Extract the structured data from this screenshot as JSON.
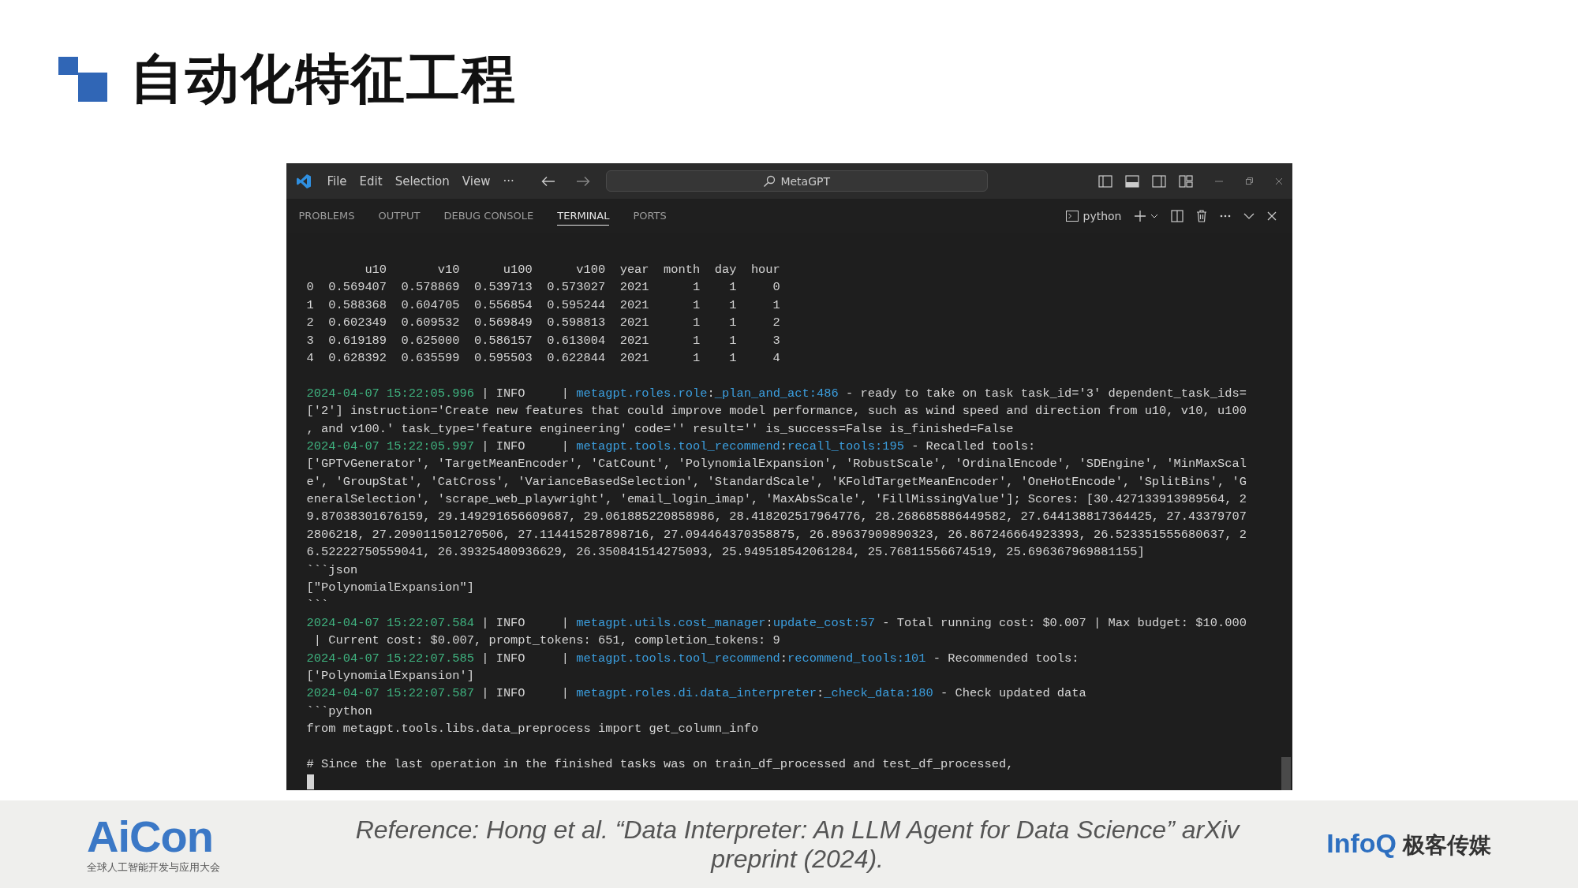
{
  "slide_title": "自动化特征工程",
  "window": {
    "menu": [
      "File",
      "Edit",
      "Selection",
      "View",
      "···"
    ],
    "command_center": "MetaGPT"
  },
  "panel": {
    "tabs": [
      {
        "label": "PROBLEMS",
        "selected": false
      },
      {
        "label": "OUTPUT",
        "selected": false
      },
      {
        "label": "DEBUG CONSOLE",
        "selected": false
      },
      {
        "label": "TERMINAL",
        "selected": true
      },
      {
        "label": "PORTS",
        "selected": false
      }
    ],
    "terminal_name": "python"
  },
  "terminal": {
    "lines": [
      {
        "kind": "text",
        "segments": [
          {
            "kind": "plain",
            "text": "        u10       v10      u100      v100  year  month  day  hour"
          }
        ]
      },
      {
        "kind": "text",
        "segments": [
          {
            "kind": "plain",
            "text": "0  0.569407  0.578869  0.539713  0.573027  2021      1    1     0"
          }
        ]
      },
      {
        "kind": "text",
        "segments": [
          {
            "kind": "plain",
            "text": "1  0.588368  0.604705  0.556854  0.595244  2021      1    1     1"
          }
        ]
      },
      {
        "kind": "text",
        "segments": [
          {
            "kind": "plain",
            "text": "2  0.602349  0.609532  0.569849  0.598813  2021      1    1     2"
          }
        ]
      },
      {
        "kind": "text",
        "segments": [
          {
            "kind": "plain",
            "text": "3  0.619189  0.625000  0.586157  0.613004  2021      1    1     3"
          }
        ]
      },
      {
        "kind": "text",
        "segments": [
          {
            "kind": "plain",
            "text": "4  0.628392  0.635599  0.595503  0.622844  2021      1    1     4"
          }
        ]
      },
      {
        "kind": "blank"
      },
      {
        "kind": "text",
        "segments": [
          {
            "kind": "time",
            "text": "2024-04-07 15:22:05.996"
          },
          {
            "kind": "plain",
            "text": " | INFO     | "
          },
          {
            "kind": "module",
            "text": "metagpt.roles.role"
          },
          {
            "kind": "plain",
            "text": ":"
          },
          {
            "kind": "module",
            "text": "_plan_and_act:486"
          },
          {
            "kind": "plain",
            "text": " - ready to take on task task_id='3' dependent_task_ids="
          }
        ]
      },
      {
        "kind": "text",
        "segments": [
          {
            "kind": "plain",
            "text": "['2'] instruction='Create new features that could improve model performance, such as wind speed and direction from u10, v10, u100"
          }
        ]
      },
      {
        "kind": "text",
        "segments": [
          {
            "kind": "plain",
            "text": ", and v100.' task_type='feature engineering' code='' result='' is_success=False is_finished=False"
          }
        ]
      },
      {
        "kind": "text",
        "segments": [
          {
            "kind": "time",
            "text": "2024-04-07 15:22:05.997"
          },
          {
            "kind": "plain",
            "text": " | INFO     | "
          },
          {
            "kind": "module",
            "text": "metagpt.tools.tool_recommend"
          },
          {
            "kind": "plain",
            "text": ":"
          },
          {
            "kind": "module",
            "text": "recall_tools:195"
          },
          {
            "kind": "plain",
            "text": " - Recalled tools:"
          }
        ]
      },
      {
        "kind": "text",
        "segments": [
          {
            "kind": "plain",
            "text": "['GPTvGenerator', 'TargetMeanEncoder', 'CatCount', 'PolynomialExpansion', 'RobustScale', 'OrdinalEncode', 'SDEngine', 'MinMaxScal"
          }
        ]
      },
      {
        "kind": "text",
        "segments": [
          {
            "kind": "plain",
            "text": "e', 'GroupStat', 'CatCross', 'VarianceBasedSelection', 'StandardScale', 'KFoldTargetMeanEncoder', 'OneHotEncode', 'SplitBins', 'G"
          }
        ]
      },
      {
        "kind": "text",
        "segments": [
          {
            "kind": "plain",
            "text": "eneralSelection', 'scrape_web_playwright', 'email_login_imap', 'MaxAbsScale', 'FillMissingValue']; Scores: [30.427133913989564, 2"
          }
        ]
      },
      {
        "kind": "text",
        "segments": [
          {
            "kind": "plain",
            "text": "9.87038301676159, 29.149291656609687, 29.061885220858986, 28.418202517964776, 28.268685886449582, 27.644138817364425, 27.43379707"
          }
        ]
      },
      {
        "kind": "text",
        "segments": [
          {
            "kind": "plain",
            "text": "2806218, 27.209011501270506, 27.114415287898716, 27.094464370358875, 26.89637909890323, 26.867246664923393, 26.523351555680637, 2"
          }
        ]
      },
      {
        "kind": "text",
        "segments": [
          {
            "kind": "plain",
            "text": "6.52222750559041, 26.39325480936629, 26.350841514275093, 25.949518542061284, 25.76811556674519, 25.696367969881155]"
          }
        ]
      },
      {
        "kind": "text",
        "segments": [
          {
            "kind": "plain",
            "text": "```json"
          }
        ]
      },
      {
        "kind": "text",
        "segments": [
          {
            "kind": "plain",
            "text": "[\"PolynomialExpansion\"]"
          }
        ]
      },
      {
        "kind": "text",
        "segments": [
          {
            "kind": "plain",
            "text": "```"
          }
        ]
      },
      {
        "kind": "text",
        "segments": [
          {
            "kind": "time",
            "text": "2024-04-07 15:22:07.584"
          },
          {
            "kind": "plain",
            "text": " | INFO     | "
          },
          {
            "kind": "module",
            "text": "metagpt.utils.cost_manager"
          },
          {
            "kind": "plain",
            "text": ":"
          },
          {
            "kind": "module",
            "text": "update_cost:57"
          },
          {
            "kind": "plain",
            "text": " - Total running cost: $0.007 | Max budget: $10.000"
          }
        ]
      },
      {
        "kind": "text",
        "segments": [
          {
            "kind": "plain",
            "text": " | Current cost: $0.007, prompt_tokens: 651, completion_tokens: 9"
          }
        ]
      },
      {
        "kind": "text",
        "segments": [
          {
            "kind": "time",
            "text": "2024-04-07 15:22:07.585"
          },
          {
            "kind": "plain",
            "text": " | INFO     | "
          },
          {
            "kind": "module",
            "text": "metagpt.tools.tool_recommend"
          },
          {
            "kind": "plain",
            "text": ":"
          },
          {
            "kind": "module",
            "text": "recommend_tools:101"
          },
          {
            "kind": "plain",
            "text": " - Recommended tools:"
          }
        ]
      },
      {
        "kind": "text",
        "segments": [
          {
            "kind": "plain",
            "text": "['PolynomialExpansion']"
          }
        ]
      },
      {
        "kind": "text",
        "segments": [
          {
            "kind": "time",
            "text": "2024-04-07 15:22:07.587"
          },
          {
            "kind": "plain",
            "text": " | INFO     | "
          },
          {
            "kind": "module",
            "text": "metagpt.roles.di.data_interpreter"
          },
          {
            "kind": "plain",
            "text": ":"
          },
          {
            "kind": "module",
            "text": "_check_data:180"
          },
          {
            "kind": "plain",
            "text": " - Check updated data"
          }
        ]
      },
      {
        "kind": "text",
        "segments": [
          {
            "kind": "plain",
            "text": "```python"
          }
        ]
      },
      {
        "kind": "text",
        "segments": [
          {
            "kind": "plain",
            "text": "from metagpt.tools.libs.data_preprocess import get_column_info"
          }
        ]
      },
      {
        "kind": "blank"
      },
      {
        "kind": "text",
        "segments": [
          {
            "kind": "plain",
            "text": "# Since the last operation in the finished tasks was on train_df_processed and test_df_processed,"
          }
        ]
      },
      {
        "kind": "cursor"
      }
    ]
  },
  "footer": {
    "logo": "AiCon",
    "logo_subtitle": "全球人工智能开发与应用大会",
    "reference": "Reference: Hong et al. “Data Interpreter: An LLM Agent for Data Science” arXiv preprint (2024).",
    "publisher": "InfoQ",
    "publisher_cn": "极客传媒"
  }
}
